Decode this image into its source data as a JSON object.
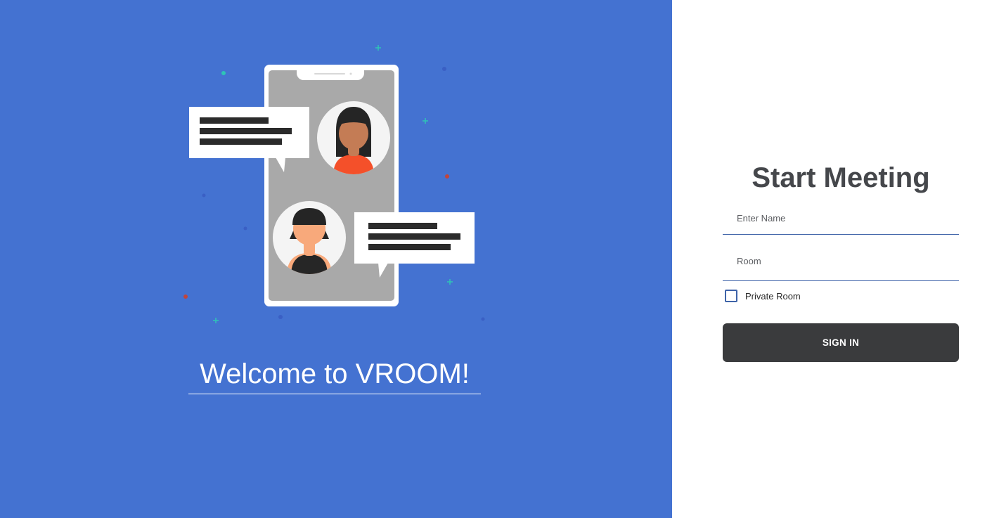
{
  "welcome": {
    "text": "Welcome to VROOM!",
    "background_color": "#4472d1"
  },
  "illustration": {
    "name": "chat-phone-illustration",
    "colors": {
      "phone": "#ffffff",
      "screen": "#a9a9a9",
      "bubble": "#ffffff",
      "text_lines": "#2b2b2b",
      "avatar_bg": "#f4f4f4",
      "person1_skin": "#c47c55",
      "person1_shirt": "#f4502a",
      "person2_skin": "#f8a97b",
      "person2_shirt": "#262626",
      "hair": "#252525"
    }
  },
  "form": {
    "title": "Start Meeting",
    "name_placeholder": "Enter Name",
    "name_value": "",
    "room_placeholder": "Room",
    "room_value": "",
    "private_room_label": "Private Room",
    "private_room_checked": false,
    "signin_label": "SIGN IN",
    "accent_color": "#3e63a8",
    "button_color": "#3a3b3d"
  }
}
